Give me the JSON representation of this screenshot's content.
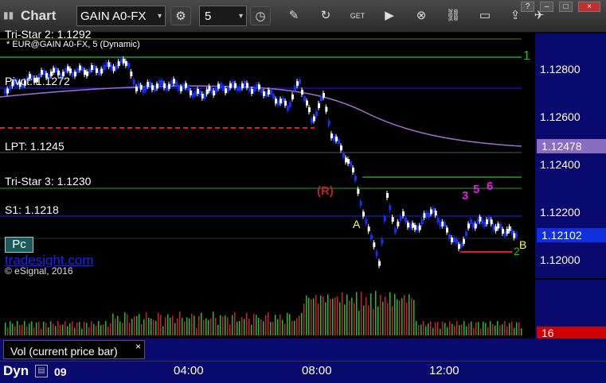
{
  "toolbar": {
    "title": "Chart",
    "symbol": "GAIN A0-FX",
    "interval": "5",
    "win_min": "–",
    "win_max": "□",
    "win_close": "×"
  },
  "chart": {
    "legend": "* EUR@GAIN A0-FX, 5 (Dynamic)",
    "watermark": "tradesight.com",
    "copyright": "© eSignal, 2016",
    "pc_label": "Pc",
    "levels": {
      "tristar2": "Tri-Star 2: 1.1292",
      "pivot": "Pivot: 1.1272",
      "lpt": "LPT: 1.1245",
      "tristar3": "Tri-Star 3: 1.1230",
      "s1": "S1: 1.1218"
    },
    "price_axis": [
      "1.12800",
      "1.12600",
      "1.12400",
      "1.12200",
      "1.12000"
    ],
    "price_boxes": {
      "ma": "1.12478",
      "last": "1.12102"
    },
    "annotations": {
      "r": "(R)",
      "a": "A",
      "b": "B",
      "n1": "1",
      "n2": "2",
      "m3": "3",
      "m5": "5",
      "m6": "6"
    }
  },
  "volume": {
    "label": "Vol (current price bar)",
    "close": "×",
    "value": "16"
  },
  "timebar": {
    "label": "Dyn",
    "day": "09",
    "times": [
      "04:00",
      "08:00",
      "12:00"
    ]
  },
  "colors": {
    "axis_bg": "#0a0a6e",
    "candle_up": "#ffffff",
    "candle_down": "#1030ff",
    "ma": "#a070d0",
    "pivot": "#2020ff",
    "lpt_red": "#e02020",
    "level_green": "#20a020"
  }
}
